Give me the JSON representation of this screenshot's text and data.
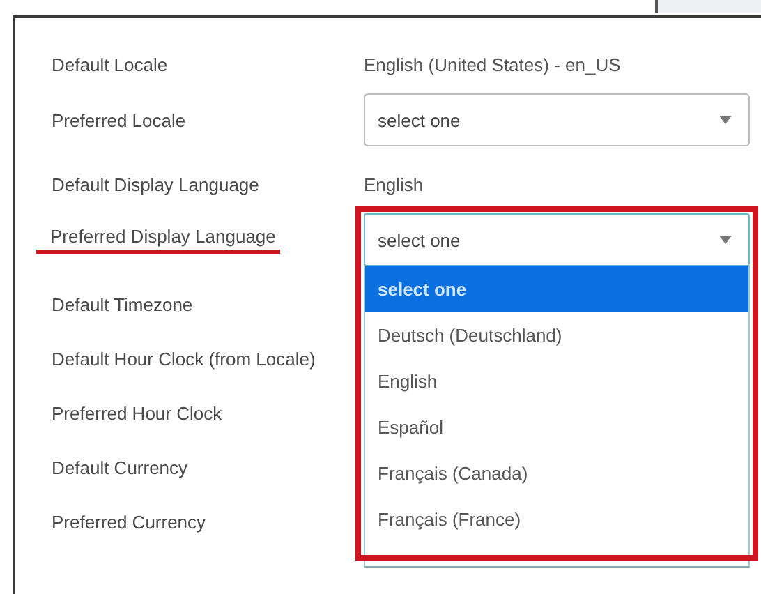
{
  "fields": [
    {
      "label": "Default Locale",
      "kind": "text",
      "value": "English (United States) - en_US",
      "underlined": false
    },
    {
      "label": "Preferred Locale",
      "kind": "select",
      "value": "select one",
      "underlined": false,
      "open": false
    },
    {
      "label": "Default Display Language",
      "kind": "text",
      "value": "English",
      "underlined": false
    },
    {
      "label": "Preferred Display Language",
      "kind": "select",
      "value": "select one",
      "underlined": true,
      "open": true,
      "outlined": true,
      "options": [
        {
          "label": "select one",
          "selected": true
        },
        {
          "label": "Deutsch (Deutschland)",
          "selected": false
        },
        {
          "label": "English",
          "selected": false
        },
        {
          "label": "Español",
          "selected": false
        },
        {
          "label": "Français (Canada)",
          "selected": false
        },
        {
          "label": "Français (France)",
          "selected": false
        }
      ]
    },
    {
      "label": "Default Timezone",
      "kind": "covered",
      "underlined": false
    },
    {
      "label": "Default Hour Clock (from Locale)",
      "kind": "covered",
      "underlined": false
    },
    {
      "label": "Preferred Hour Clock",
      "kind": "covered",
      "underlined": false
    },
    {
      "label": "Default Currency",
      "kind": "covered",
      "underlined": false
    },
    {
      "label": "Preferred Currency",
      "kind": "covered",
      "underlined": false
    }
  ]
}
